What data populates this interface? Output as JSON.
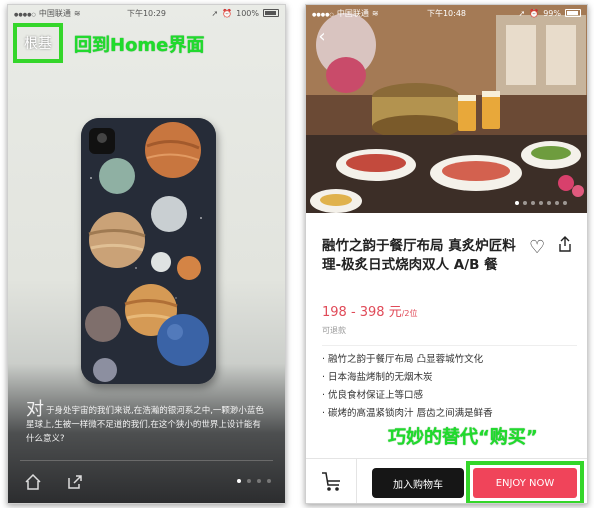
{
  "left": {
    "status": {
      "carrier": "中国联通",
      "time": "下午10:29",
      "battery": "100%"
    },
    "logo_text": "根基",
    "annotation": "回到Home界面",
    "story_big": "对",
    "story_text": "于身处宇宙的我们来说,在浩瀚的银河系之中,一颗渺小蓝色星球上,生被一样微不足道的我们,在这个狭小的世界上设计能有什么意义?",
    "home_icon": "home-icon",
    "share_icon": "share-icon",
    "page_count": 4,
    "page_active": 1
  },
  "right": {
    "status": {
      "carrier": "中国联通",
      "time": "下午10:48",
      "battery": "99%"
    },
    "title": "融竹之韵于餐厅布局 真炙炉匠料理-极炙日式烧肉双人 A/B 餐",
    "price": "198 - 398 元",
    "price_unit": "/2位",
    "refund": "可退款",
    "bullets": [
      "融竹之韵于餐厅布局 凸显蓉城竹文化",
      "日本海盐烤制的无烟木炭",
      "优良食材保证上等口感",
      "碳烤的高温紧锁肉汁 唇齿之间满是鲜香"
    ],
    "annotation": "巧妙的替代“购买”",
    "add_cart_label": "加入购物车",
    "enjoy_label": "ENJOY NOW",
    "image_count": 7,
    "image_active": 1
  },
  "colors": {
    "highlight": "#34d62a",
    "annotation": "#1fdc2c",
    "price": "#e04a58",
    "enjoy": "#f0445a",
    "dark_button": "#161616"
  }
}
